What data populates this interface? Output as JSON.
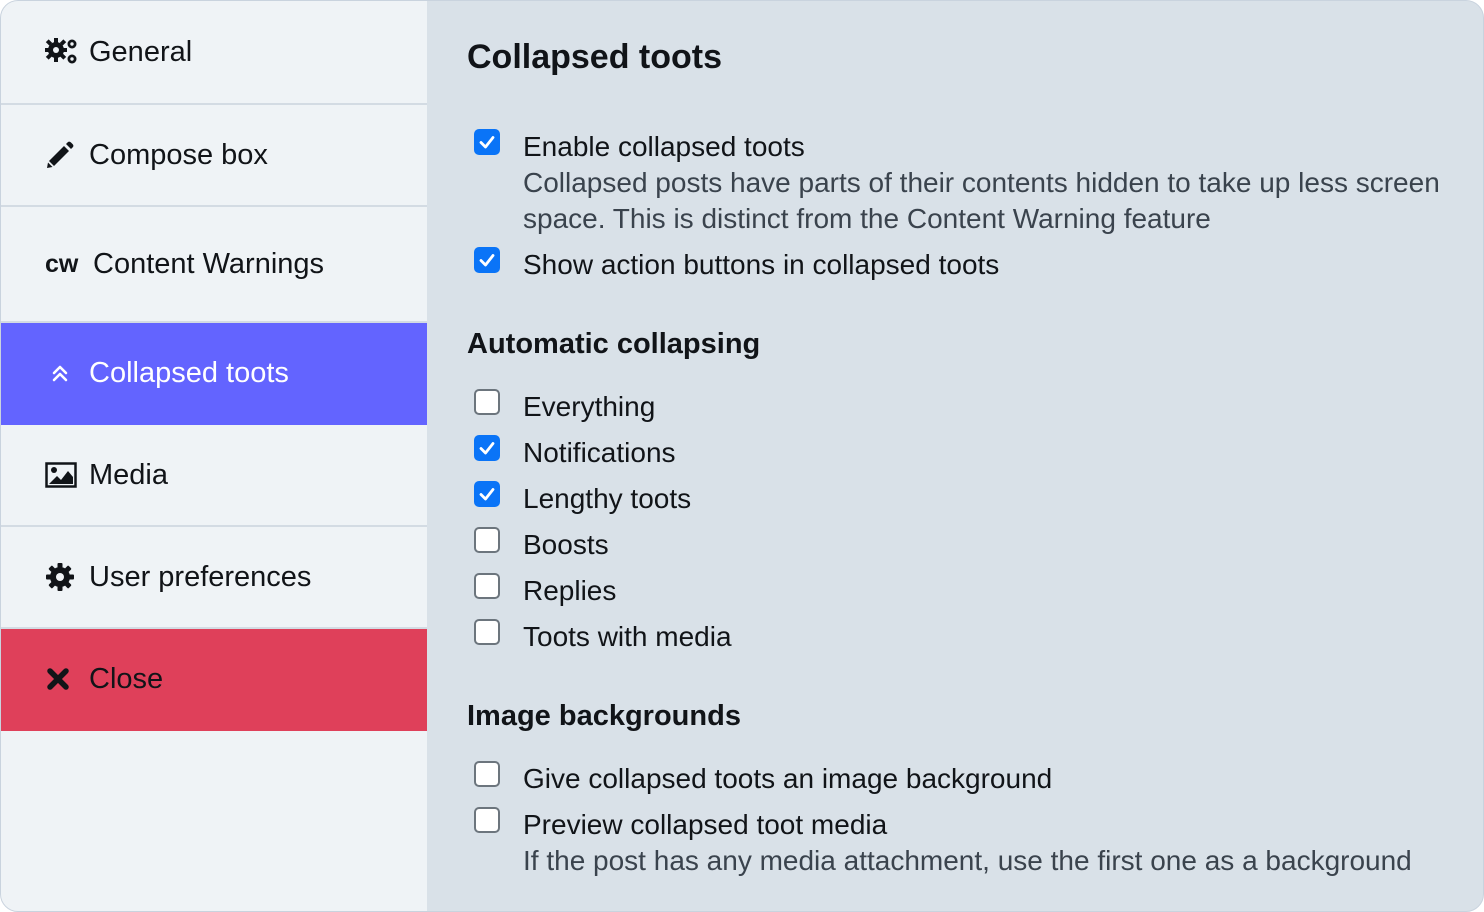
{
  "sidebar": {
    "items": [
      {
        "label": "General",
        "icon": "gears-icon"
      },
      {
        "label": "Compose box",
        "icon": "pencil-icon"
      },
      {
        "label": "Content Warnings",
        "icon": "cw-icon",
        "icon_text": "cw"
      },
      {
        "label": "Collapsed toots",
        "icon": "angle-double-up-icon",
        "active": true
      },
      {
        "label": "Media",
        "icon": "image-icon"
      },
      {
        "label": "User preferences",
        "icon": "cog-icon"
      },
      {
        "label": "Close",
        "icon": "times-icon"
      }
    ]
  },
  "main": {
    "title": "Collapsed toots",
    "options": [
      {
        "label": "Enable collapsed toots",
        "checked": true,
        "hint": "Collapsed posts have parts of their contents hidden to take up less screen space. This is distinct from the Content Warning feature"
      },
      {
        "label": "Show action buttons in collapsed toots",
        "checked": true
      }
    ],
    "auto_collapse": {
      "title": "Automatic collapsing",
      "options": [
        {
          "label": "Everything",
          "checked": false
        },
        {
          "label": "Notifications",
          "checked": true
        },
        {
          "label": "Lengthy toots",
          "checked": true
        },
        {
          "label": "Boosts",
          "checked": false
        },
        {
          "label": "Replies",
          "checked": false
        },
        {
          "label": "Toots with media",
          "checked": false
        }
      ]
    },
    "backgrounds": {
      "title": "Image backgrounds",
      "options": [
        {
          "label": "Give collapsed toots an image background",
          "checked": false
        },
        {
          "label": "Preview collapsed toot media",
          "checked": false,
          "hint": "If the post has any media attachment, use the first one as a background"
        }
      ]
    }
  },
  "colors": {
    "active": "#6364ff",
    "close": "#df405a",
    "checkbox": "#0a74f7"
  }
}
